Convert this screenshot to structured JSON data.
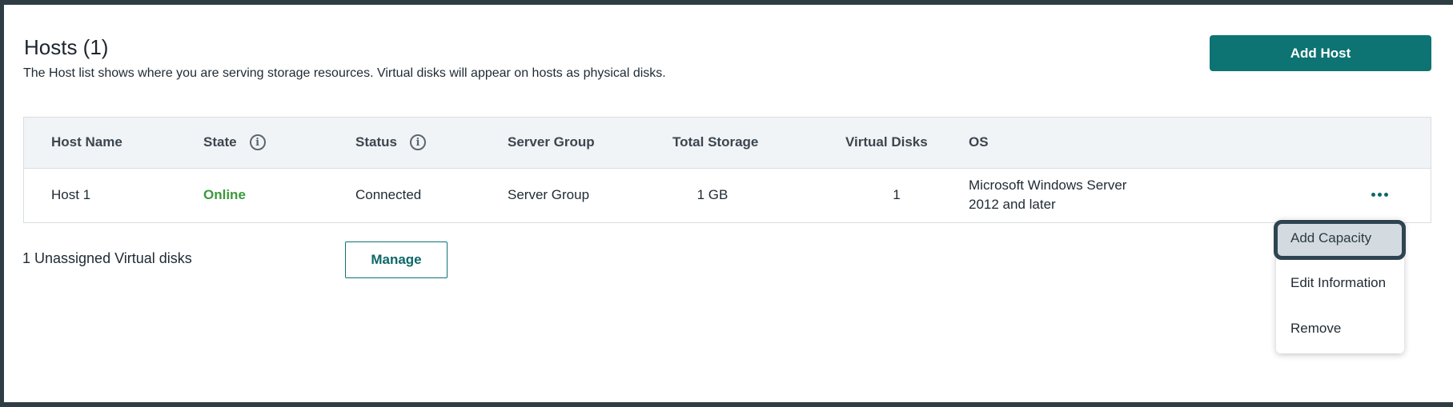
{
  "header": {
    "title": "Hosts (1)",
    "description": "The Host list shows where you are serving storage resources. Virtual disks will appear on hosts as physical disks.",
    "add_host_label": "Add Host"
  },
  "table": {
    "columns": {
      "host_name": "Host Name",
      "state": "State",
      "status": "Status",
      "server_group": "Server Group",
      "total_storage": "Total Storage",
      "virtual_disks": "Virtual Disks",
      "os": "OS"
    },
    "rows": [
      {
        "host_name": "Host 1",
        "state": "Online",
        "status": "Connected",
        "server_group": "Server Group",
        "total_storage": "1 GB",
        "virtual_disks": "1",
        "os": "Microsoft Windows Server 2012 and later"
      }
    ]
  },
  "unassigned": {
    "text": "1 Unassigned Virtual disks",
    "manage_label": "Manage"
  },
  "row_menu": {
    "items": [
      "Add Capacity",
      "Edit Information",
      "Remove"
    ],
    "active_item": "Add Capacity"
  },
  "colors": {
    "accent": "#0d7373",
    "online": "#3a9a3a",
    "header_bg": "#f1f4f6"
  }
}
